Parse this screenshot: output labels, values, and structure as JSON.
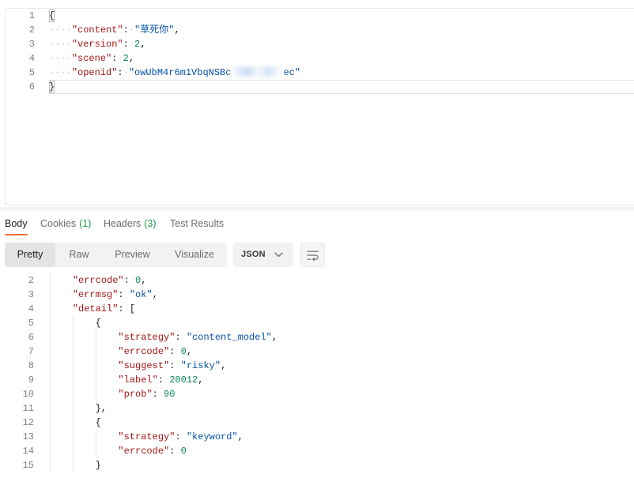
{
  "request_editor": {
    "lines": [
      {
        "n": "1",
        "tokens": [
          {
            "k": "punct",
            "v": "{",
            "match": true
          }
        ]
      },
      {
        "n": "2",
        "tokens": [
          {
            "k": "ws",
            "v": "····"
          },
          {
            "k": "key",
            "v": "\"content\""
          },
          {
            "k": "punct",
            "v": ":"
          },
          {
            "k": "ws",
            "v": "·"
          },
          {
            "k": "str",
            "v": "\"草死你\""
          },
          {
            "k": "punct",
            "v": ","
          }
        ]
      },
      {
        "n": "3",
        "tokens": [
          {
            "k": "ws",
            "v": "····"
          },
          {
            "k": "key",
            "v": "\"version\""
          },
          {
            "k": "punct",
            "v": ":"
          },
          {
            "k": "ws",
            "v": "·"
          },
          {
            "k": "num",
            "v": "2"
          },
          {
            "k": "punct",
            "v": ","
          }
        ]
      },
      {
        "n": "4",
        "tokens": [
          {
            "k": "ws",
            "v": "····"
          },
          {
            "k": "key",
            "v": "\"scene\""
          },
          {
            "k": "punct",
            "v": ":"
          },
          {
            "k": "ws",
            "v": "·"
          },
          {
            "k": "num",
            "v": "2"
          },
          {
            "k": "punct",
            "v": ","
          }
        ]
      },
      {
        "n": "5",
        "tokens": [
          {
            "k": "ws",
            "v": "····"
          },
          {
            "k": "key",
            "v": "\"openid\""
          },
          {
            "k": "punct",
            "v": ":"
          },
          {
            "k": "ws",
            "v": "·"
          },
          {
            "k": "str",
            "v": "\"owUbM4r6m1VbqNSBc"
          },
          {
            "k": "redacted"
          },
          {
            "k": "str",
            "v": "ec\""
          }
        ]
      },
      {
        "n": "6",
        "active": true,
        "tokens": [
          {
            "k": "punct",
            "v": "}",
            "match": true
          }
        ]
      }
    ]
  },
  "response_tabs": [
    {
      "label": "Body",
      "count": "",
      "active": true
    },
    {
      "label": "Cookies",
      "count": "(1)",
      "active": false
    },
    {
      "label": "Headers",
      "count": "(3)",
      "active": false
    },
    {
      "label": "Test Results",
      "count": "",
      "active": false
    }
  ],
  "view_modes": [
    {
      "label": "Pretty",
      "selected": true
    },
    {
      "label": "Raw",
      "selected": false
    },
    {
      "label": "Preview",
      "selected": false
    },
    {
      "label": "Visualize",
      "selected": false
    }
  ],
  "language_select": {
    "value": "JSON",
    "icon": "chevron-down-icon"
  },
  "wrap_button": {
    "icon": "wrap-lines-icon"
  },
  "response_body": {
    "lines": [
      {
        "n": "2",
        "tokens": [
          {
            "k": "sp",
            "v": "    "
          },
          {
            "k": "key",
            "v": "\"errcode\""
          },
          {
            "k": "punct",
            "v": ": "
          },
          {
            "k": "num",
            "v": "0"
          },
          {
            "k": "punct",
            "v": ","
          }
        ]
      },
      {
        "n": "3",
        "tokens": [
          {
            "k": "sp",
            "v": "    "
          },
          {
            "k": "key",
            "v": "\"errmsg\""
          },
          {
            "k": "punct",
            "v": ": "
          },
          {
            "k": "str",
            "v": "\"ok\""
          },
          {
            "k": "punct",
            "v": ","
          }
        ]
      },
      {
        "n": "4",
        "tokens": [
          {
            "k": "sp",
            "v": "    "
          },
          {
            "k": "key",
            "v": "\"detail\""
          },
          {
            "k": "punct",
            "v": ": ["
          }
        ]
      },
      {
        "n": "5",
        "tokens": [
          {
            "k": "sp",
            "v": "        "
          },
          {
            "k": "punct",
            "v": "{"
          }
        ]
      },
      {
        "n": "6",
        "tokens": [
          {
            "k": "sp",
            "v": "            "
          },
          {
            "k": "key",
            "v": "\"strategy\""
          },
          {
            "k": "punct",
            "v": ": "
          },
          {
            "k": "str",
            "v": "\"content_model\""
          },
          {
            "k": "punct",
            "v": ","
          }
        ]
      },
      {
        "n": "7",
        "tokens": [
          {
            "k": "sp",
            "v": "            "
          },
          {
            "k": "key",
            "v": "\"errcode\""
          },
          {
            "k": "punct",
            "v": ": "
          },
          {
            "k": "num",
            "v": "0"
          },
          {
            "k": "punct",
            "v": ","
          }
        ]
      },
      {
        "n": "8",
        "tokens": [
          {
            "k": "sp",
            "v": "            "
          },
          {
            "k": "key",
            "v": "\"suggest\""
          },
          {
            "k": "punct",
            "v": ": "
          },
          {
            "k": "str",
            "v": "\"risky\""
          },
          {
            "k": "punct",
            "v": ","
          }
        ]
      },
      {
        "n": "9",
        "tokens": [
          {
            "k": "sp",
            "v": "            "
          },
          {
            "k": "key",
            "v": "\"label\""
          },
          {
            "k": "punct",
            "v": ": "
          },
          {
            "k": "num",
            "v": "20012"
          },
          {
            "k": "punct",
            "v": ","
          }
        ]
      },
      {
        "n": "10",
        "tokens": [
          {
            "k": "sp",
            "v": "            "
          },
          {
            "k": "key",
            "v": "\"prob\""
          },
          {
            "k": "punct",
            "v": ": "
          },
          {
            "k": "num",
            "v": "90"
          }
        ]
      },
      {
        "n": "11",
        "tokens": [
          {
            "k": "sp",
            "v": "        "
          },
          {
            "k": "punct",
            "v": "},"
          }
        ]
      },
      {
        "n": "12",
        "tokens": [
          {
            "k": "sp",
            "v": "        "
          },
          {
            "k": "punct",
            "v": "{"
          }
        ]
      },
      {
        "n": "13",
        "tokens": [
          {
            "k": "sp",
            "v": "            "
          },
          {
            "k": "key",
            "v": "\"strategy\""
          },
          {
            "k": "punct",
            "v": ": "
          },
          {
            "k": "str",
            "v": "\"keyword\""
          },
          {
            "k": "punct",
            "v": ","
          }
        ]
      },
      {
        "n": "14",
        "tokens": [
          {
            "k": "sp",
            "v": "            "
          },
          {
            "k": "key",
            "v": "\"errcode\""
          },
          {
            "k": "punct",
            "v": ": "
          },
          {
            "k": "num",
            "v": "0"
          }
        ]
      },
      {
        "n": "15",
        "tokens": [
          {
            "k": "sp",
            "v": "        "
          },
          {
            "k": "punct",
            "v": "}"
          }
        ]
      }
    ]
  },
  "colors": {
    "accent": "#ff6c37",
    "count_badge": "#1b9e4b",
    "json_key": "#a31515",
    "json_string": "#0451a5",
    "json_number": "#098658"
  }
}
